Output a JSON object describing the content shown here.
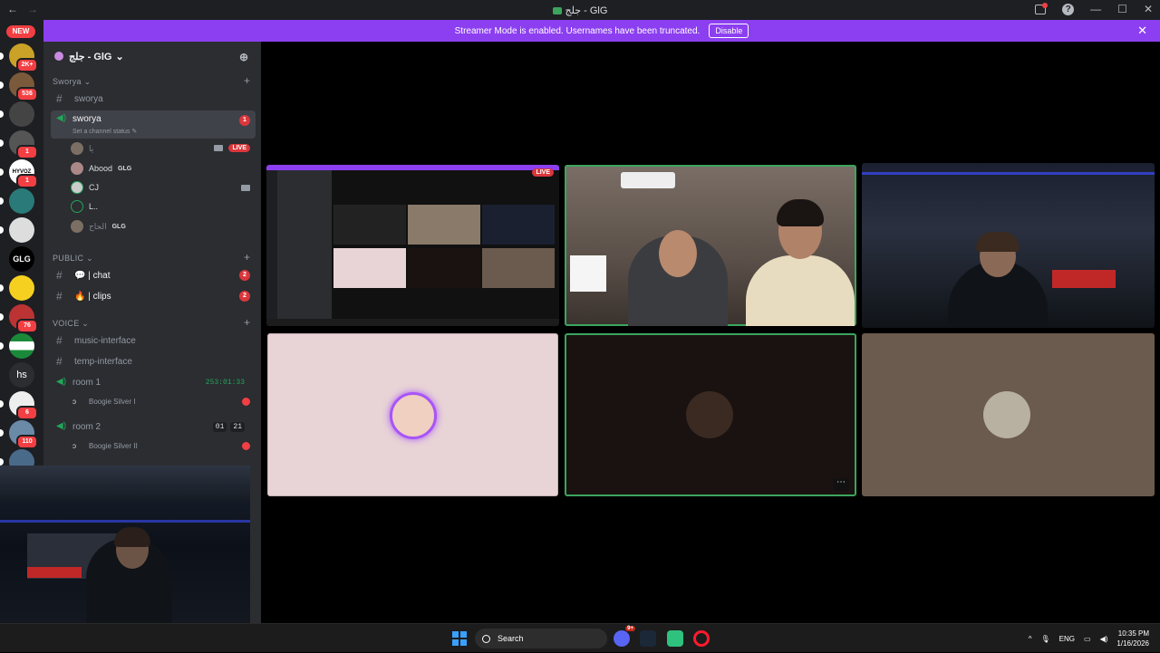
{
  "window": {
    "title": "جلج - GlG",
    "back_label": "←",
    "forward_label": "→",
    "help_label": "?",
    "min_label": "—",
    "max_label": "☐",
    "close_label": "✕"
  },
  "banner": {
    "text": "Streamer Mode is enabled. Usernames have been truncated.",
    "button": "Disable",
    "close": "✕"
  },
  "rail": {
    "new_label": "NEW",
    "servers": [
      {
        "name": "server-a",
        "badge": "2K+",
        "color": "#c9a227"
      },
      {
        "name": "server-b",
        "badge": "536",
        "color": "#7a5a3a"
      },
      {
        "name": "server-c",
        "badge": "",
        "color": "#444"
      },
      {
        "name": "server-d",
        "badge": "1",
        "color": "#555"
      },
      {
        "name": "server-e",
        "badge": "1",
        "label": "HYVOZ",
        "color": "#fff"
      },
      {
        "name": "server-f",
        "badge": "",
        "color": "#2a7a7a"
      },
      {
        "name": "server-g",
        "badge": "",
        "color": "#ddd"
      },
      {
        "name": "server-glg",
        "badge": "",
        "label": "GLG",
        "color": "#000"
      },
      {
        "name": "server-h",
        "badge": "",
        "color": "#f5d020"
      },
      {
        "name": "server-i",
        "badge": "76",
        "color": "#b33"
      },
      {
        "name": "server-j",
        "badge": "",
        "color": "#1a8a3a"
      },
      {
        "name": "server-hs",
        "badge": "",
        "label": "hs",
        "color": "#2b2d31"
      },
      {
        "name": "server-k",
        "badge": "6",
        "color": "#eee"
      },
      {
        "name": "server-l",
        "badge": "110",
        "color": "#6a8aa8"
      },
      {
        "name": "server-m",
        "badge": "",
        "color": "#4a6a8a"
      }
    ]
  },
  "guild": {
    "name": "جلج - GlG",
    "chevron": "⌄",
    "add_user": "⊕"
  },
  "categories": {
    "sworya": "Sworya ⌄",
    "public": "PUBLIC ⌄",
    "voice": "VOICE ⌄"
  },
  "channels": {
    "sworya_text": "sworya",
    "sworya_voice": "sworya",
    "sworya_badge": "1",
    "sworya_status": "Set a channel status ✎",
    "chat": "💬 | chat",
    "chat_badge": "2",
    "clips": "🔥 | clips",
    "clips_badge": "2",
    "music": "music-interface",
    "temp": "temp-interface",
    "room1": "room 1",
    "room1_timer": "253:01:33",
    "room2": "room 2",
    "room2_a": "01",
    "room2_b": "21"
  },
  "voice_users": [
    {
      "name": "يا",
      "tag": "",
      "live": "LIVE"
    },
    {
      "name": "Abood",
      "tag": "GLG"
    },
    {
      "name": "CJ",
      "tag": ""
    },
    {
      "name": "L..",
      "tag": ""
    },
    {
      "name": "الحاج",
      "tag": "GLG"
    }
  ],
  "bots": {
    "room1_bot": "Boogie Silver I",
    "room2_bot": "Boogie Silver II"
  },
  "stage": {
    "screen_live": "LIVE",
    "tile_menu": "⋯",
    "colors": {
      "speaking": "#3ba55d",
      "tile_pink": "#e8d3d6",
      "tile_dark": "#1a1210",
      "tile_brown": "#6b5a4e"
    }
  },
  "taskbar": {
    "search": "Search",
    "discord_badge": "9+",
    "lang": "ENG",
    "time": "10:35 PM",
    "date": "1/16/2026"
  }
}
